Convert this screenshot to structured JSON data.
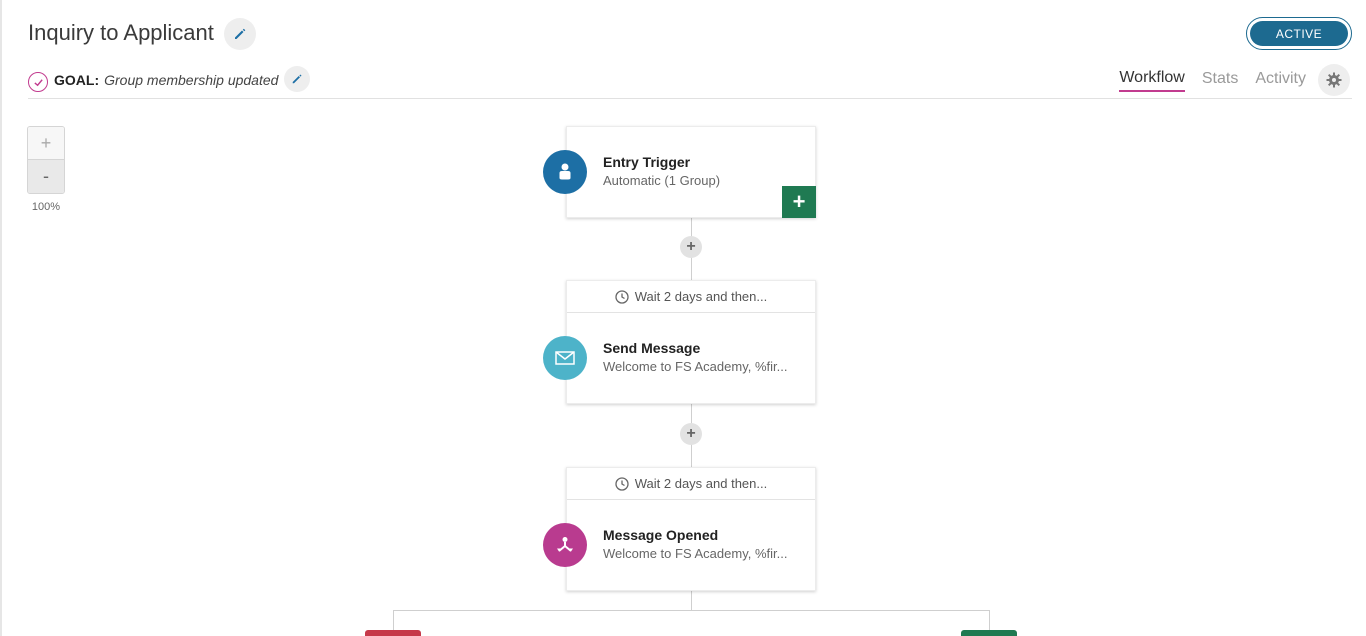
{
  "header": {
    "title": "Inquiry to Applicant",
    "status": "ACTIVE",
    "goal_label": "GOAL:",
    "goal_text": "Group membership updated"
  },
  "tabs": [
    {
      "label": "Workflow",
      "active": true
    },
    {
      "label": "Stats",
      "active": false
    },
    {
      "label": "Activity",
      "active": false
    }
  ],
  "zoom": {
    "in_label": "+",
    "out_label": "-",
    "level": "100%"
  },
  "workflow": {
    "add_step_label": "+",
    "steps": [
      {
        "title": "Entry Trigger",
        "subtitle": "Automatic (1 Group)",
        "icon": "person-icon",
        "color": "#1d6fa5"
      },
      {
        "wait": "Wait 2 days and then...",
        "title": "Send Message",
        "subtitle": "Welcome to FS Academy, %fir...",
        "icon": "envelope-icon",
        "color": "#4db3c9"
      },
      {
        "wait": "Wait 2 days and then...",
        "title": "Message Opened",
        "subtitle": "Welcome to FS Academy, %fir...",
        "icon": "branch-icon",
        "color": "#b93b8f"
      }
    ]
  },
  "colors": {
    "accent": "#c23b8f",
    "primary": "#1d6a90",
    "success": "#1f7a52",
    "danger": "#c6394a"
  }
}
